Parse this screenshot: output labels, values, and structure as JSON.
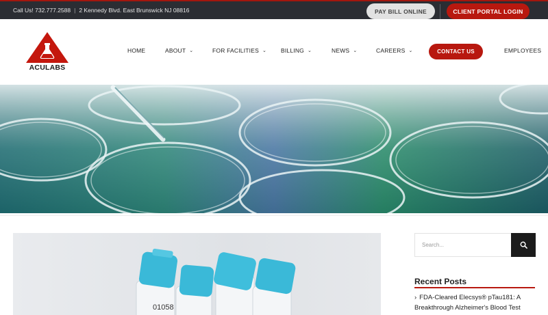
{
  "topbar": {
    "phone": "Call Us! 732.777.2588",
    "separator": "|",
    "address": "2 Kennedy Blvd. East Brunswick NJ 08816",
    "pay_bill_label": "PAY BILL ONLINE",
    "client_portal_label": "CLIENT PORTAL LOGIN"
  },
  "logo": {
    "text": "ACULABS"
  },
  "nav": {
    "items": [
      {
        "label": "HOME",
        "has_dropdown": false
      },
      {
        "label": "ABOUT",
        "has_dropdown": true
      },
      {
        "label": "FOR FACILITIES",
        "has_dropdown": true
      },
      {
        "label": "BILLING",
        "has_dropdown": true
      },
      {
        "label": "NEWS",
        "has_dropdown": true
      },
      {
        "label": "CAREERS",
        "has_dropdown": true
      }
    ],
    "contact_label": "CONTACT US",
    "employees_label": "EMPLOYEES",
    "chevron": "⌄"
  },
  "hero": {
    "icon": "test-tubes-banner"
  },
  "post": {
    "tube_label": "01058"
  },
  "sidebar": {
    "search_placeholder": "Search...",
    "recent_posts_title": "Recent Posts",
    "recent_posts": [
      {
        "arrow": "›",
        "title": "FDA-Cleared Elecsys® pTau181: A Breakthrough Alzheimer's Blood Test"
      }
    ]
  },
  "colors": {
    "brand_red": "#b8180f",
    "topbar_bg": "#2b2d33",
    "text_dark": "#222222"
  }
}
